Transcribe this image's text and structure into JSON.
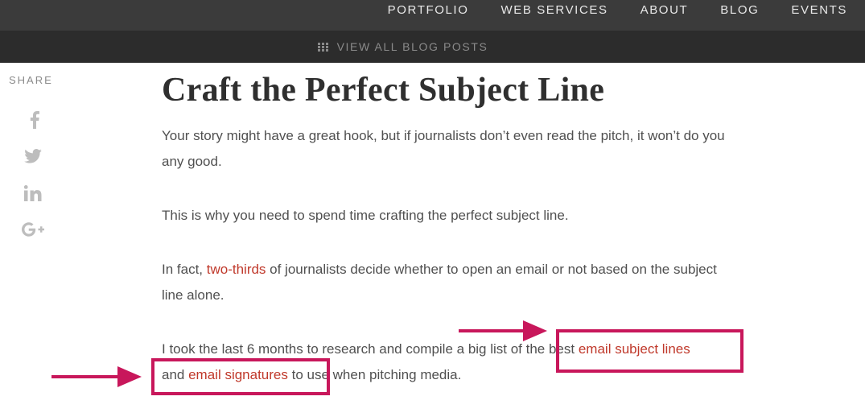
{
  "nav": {
    "items": [
      "PORTFOLIO",
      "WEB SERVICES",
      "ABOUT",
      "BLOG",
      "EVENTS"
    ]
  },
  "subnav": {
    "label": "VIEW ALL BLOG POSTS",
    "icon": "grid-icon"
  },
  "share": {
    "label": "SHARE",
    "icons": [
      "facebook-icon",
      "twitter-icon",
      "linkedin-icon",
      "google-plus-icon"
    ]
  },
  "article": {
    "title": "Craft the Perfect Subject Line",
    "p1": "Your story might have a great hook, but if journalists don’t even read the pitch, it won’t do you any good.",
    "p2": "This is why you need to spend time crafting the perfect subject line.",
    "p3_before": "In fact, ",
    "p3_link": "two-thirds",
    "p3_after": " of journalists decide whether to open an email or not based on the subject line alone.",
    "p4_before": "I took the last 6 months to research and compile a big list of the best ",
    "p4_link1": "email subject lines",
    "p4_middle": " and ",
    "p4_link2": "email signatures",
    "p4_after": " to use when pitching media."
  },
  "colors": {
    "nav_bg": "#3b3b3b",
    "subnav_bg": "#2c2c2c",
    "link": "#c0392b",
    "annotation": "#c8175b"
  }
}
